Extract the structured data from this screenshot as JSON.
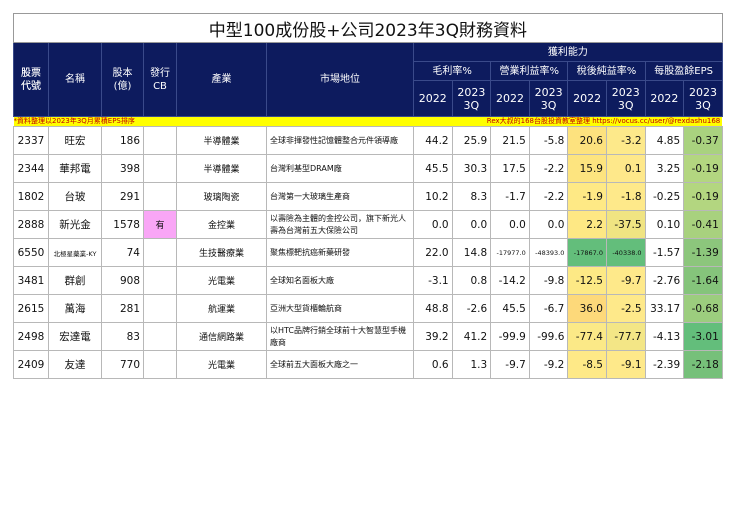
{
  "title": "中型100成份股+公司2023年3Q財務資料",
  "headers": {
    "code": "股票代號",
    "code_l1": "股票",
    "code_l2": "代號",
    "name": "名稱",
    "capital_l1": "股本",
    "capital_l2": "(億)",
    "cb_l1": "發行",
    "cb_l2": "CB",
    "industry": "產業",
    "position": "市場地位",
    "profit": "獲利能力",
    "gross": "毛利率%",
    "operating": "營業利益率%",
    "net": "稅後純益率%",
    "eps": "每股盈餘EPS",
    "y2022": "2022",
    "y2023a": "2023",
    "y2023b": "3Q"
  },
  "note_left": "*資料整理以2023年3Q月累積EPS排序",
  "note_right": "Rex大叔的168台股投資教室整理 https://vocus.cc/user/@rexdashu168",
  "rows": [
    {
      "code": "2337",
      "name": "旺宏",
      "capital": "186",
      "cb": "",
      "industry": "半導體業",
      "position": "全球非揮發性記憶體整合元件領導廠",
      "v": [
        "44.2",
        "25.9",
        "21.5",
        "-5.8",
        "20.6",
        "-3.2",
        "4.85",
        "-0.37"
      ],
      "bg": [
        "",
        "",
        "",
        "",
        "#fde27e",
        "#fde98a",
        "",
        "#a9d27f"
      ]
    },
    {
      "code": "2344",
      "name": "華邦電",
      "capital": "398",
      "cb": "",
      "industry": "半導體業",
      "position": "台灣利基型DRAM廠",
      "v": [
        "45.5",
        "30.3",
        "17.5",
        "-2.2",
        "15.9",
        "0.1",
        "3.25",
        "-0.19"
      ],
      "bg": [
        "",
        "",
        "",
        "",
        "#fde47f",
        "#fee88a",
        "",
        "#b3d680"
      ]
    },
    {
      "code": "1802",
      "name": "台玻",
      "capital": "291",
      "cb": "",
      "industry": "玻璃陶瓷",
      "position": "台灣第一大玻璃生產商",
      "v": [
        "10.2",
        "8.3",
        "-1.7",
        "-2.2",
        "-1.9",
        "-1.8",
        "-0.25",
        "-0.19"
      ],
      "bg": [
        "",
        "",
        "",
        "",
        "#fee985",
        "#fee98a",
        "",
        "#b3d680"
      ]
    },
    {
      "code": "2888",
      "name": "新光金",
      "capital": "1578",
      "cb": "有",
      "industry": "金控業",
      "position": "以壽險為主體的金控公司，旗下新光人壽為台灣前五大保險公司",
      "v": [
        "0.0",
        "0.0",
        "0.0",
        "0.0",
        "2.2",
        "-37.5",
        "0.10",
        "-0.41"
      ],
      "bg": [
        "",
        "",
        "",
        "",
        "#fee884",
        "#f0e482",
        "",
        "#a8d17e"
      ]
    },
    {
      "code": "6550",
      "name": "北極星藥業-KY",
      "capital": "74",
      "cb": "",
      "industry": "生技醫療業",
      "position": "聚焦標靶抗癌新藥研發",
      "v": [
        "22.0",
        "14.8",
        "-17977.0",
        "-48393.0",
        "-17867.0",
        "-40338.0",
        "-1.57",
        "-1.39"
      ],
      "bg": [
        "",
        "",
        "",
        "",
        "#63be7b",
        "#63be7b",
        "",
        "#8cc67c"
      ]
    },
    {
      "code": "3481",
      "name": "群創",
      "capital": "908",
      "cb": "",
      "industry": "光電業",
      "position": "全球知名面板大廠",
      "v": [
        "-3.1",
        "0.8",
        "-14.2",
        "-9.8",
        "-12.5",
        "-9.7",
        "-2.76",
        "-1.64"
      ],
      "bg": [
        "",
        "",
        "",
        "",
        "#fde985",
        "#fee98a",
        "",
        "#85c47b"
      ]
    },
    {
      "code": "2615",
      "name": "萬海",
      "capital": "281",
      "cb": "",
      "industry": "航運業",
      "position": "亞洲大型貨櫃輪航商",
      "v": [
        "48.8",
        "-2.6",
        "45.5",
        "-6.7",
        "36.0",
        "-2.5",
        "33.17",
        "-0.68"
      ],
      "bg": [
        "",
        "",
        "",
        "",
        "#fdd97a",
        "#fee98a",
        "",
        "#9ccd7e"
      ]
    },
    {
      "code": "2498",
      "name": "宏達電",
      "capital": "83",
      "cb": "",
      "industry": "通信網路業",
      "position": "以HTC品牌行銷全球前十大智慧型手機廠商",
      "v": [
        "39.2",
        "41.2",
        "-99.9",
        "-99.6",
        "-77.4",
        "-77.7",
        "-4.13",
        "-3.01"
      ],
      "bg": [
        "",
        "",
        "",
        "",
        "#fbe987",
        "#f3e686",
        "",
        "#63be7b"
      ]
    },
    {
      "code": "2409",
      "name": "友達",
      "capital": "770",
      "cb": "",
      "industry": "光電業",
      "position": "全球前五大面板大廠之一",
      "v": [
        "0.6",
        "1.3",
        "-9.7",
        "-9.2",
        "-8.5",
        "-9.1",
        "-2.39",
        "-2.18"
      ],
      "bg": [
        "",
        "",
        "",
        "",
        "#fee987",
        "#fee98a",
        "",
        "#76c07a"
      ]
    }
  ],
  "colors": {
    "header": "#0d1b5e",
    "note": "#ffff00",
    "cb_highlight": "#f9a6f6"
  }
}
